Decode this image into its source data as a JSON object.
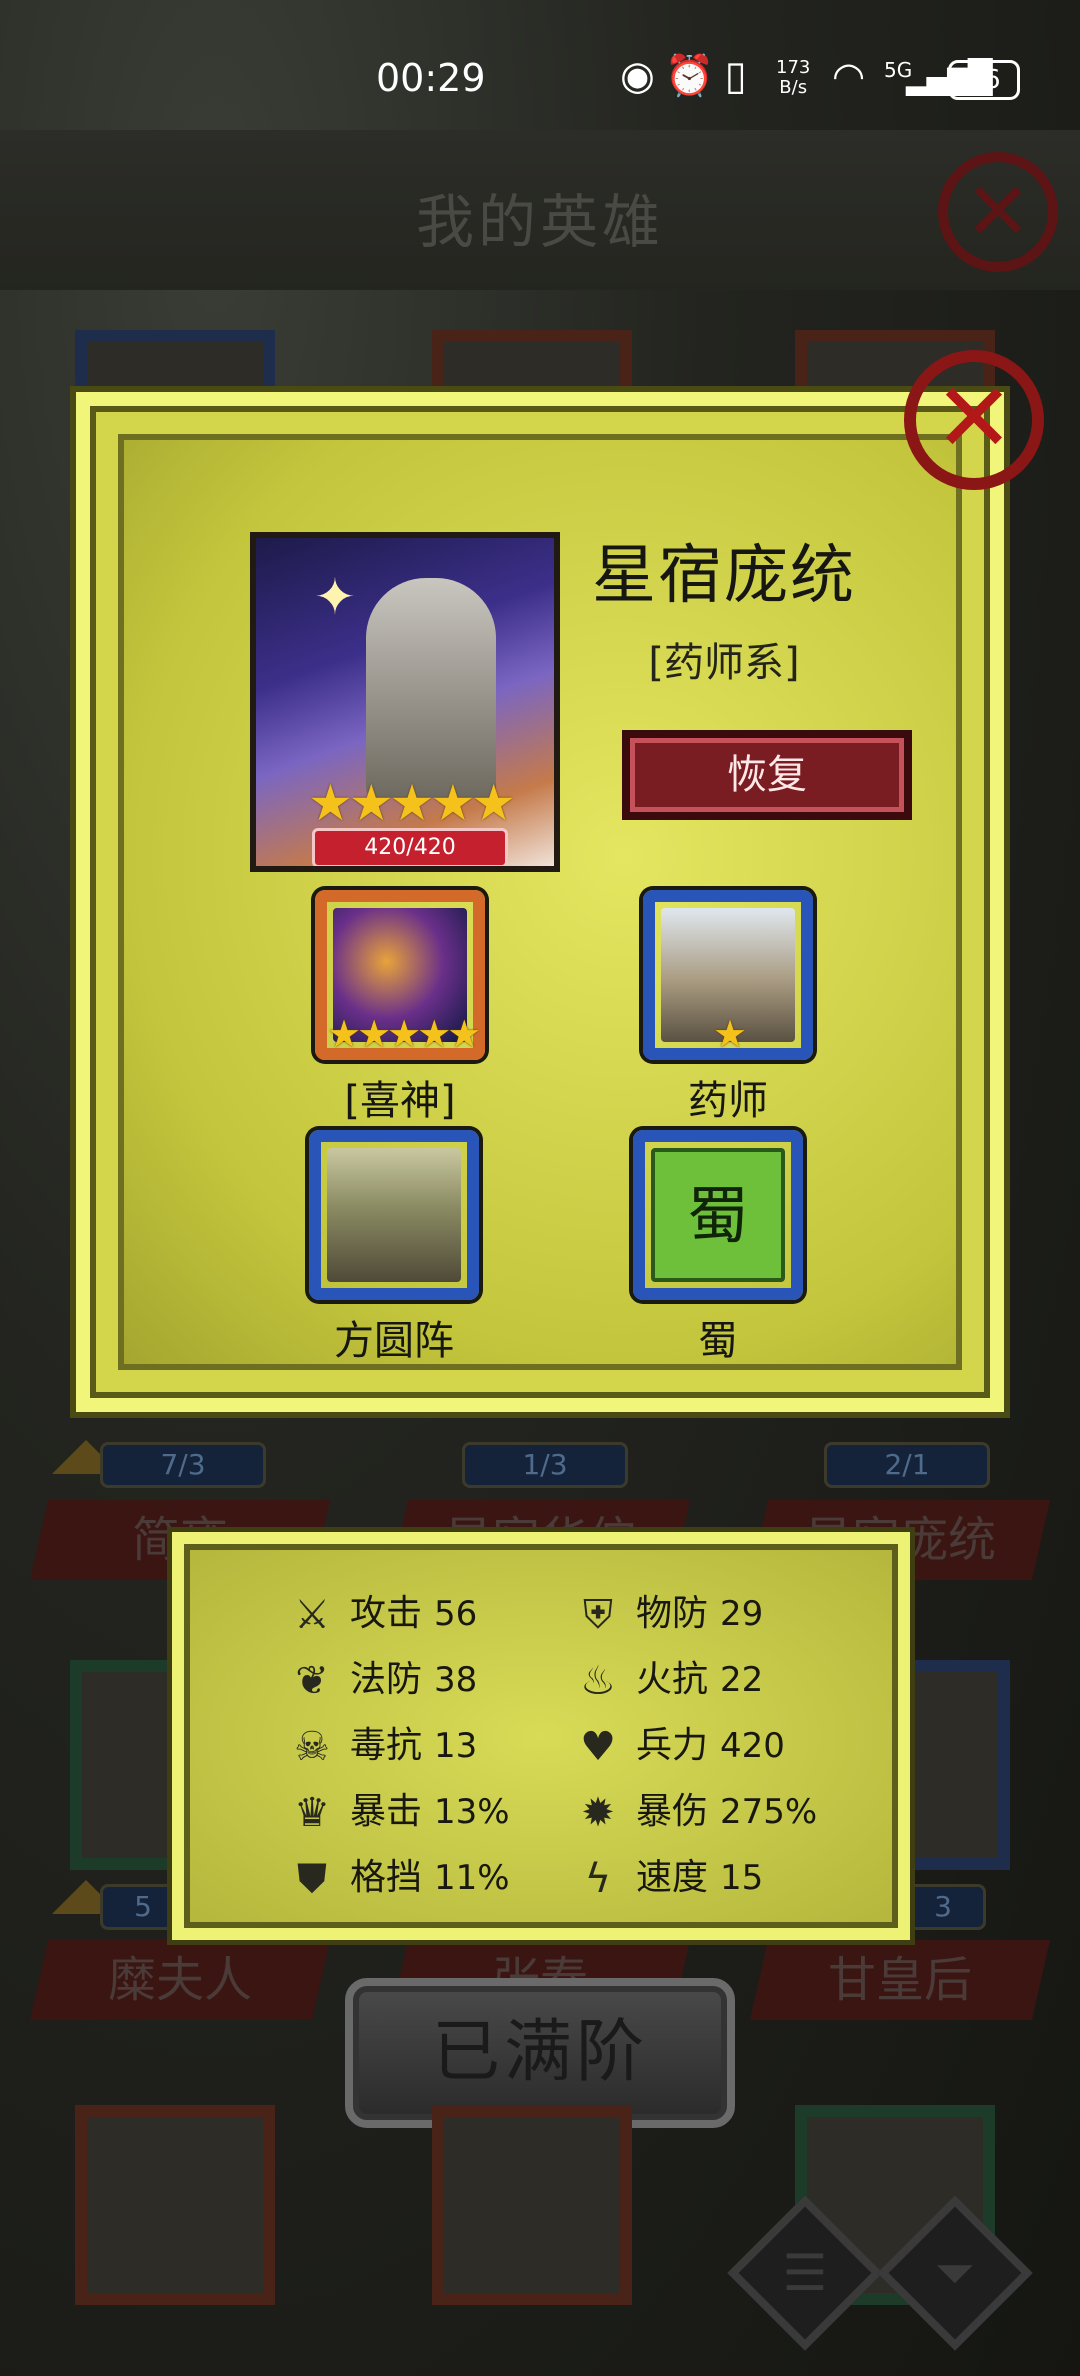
{
  "status_bar": {
    "time": "00:29",
    "net_speed_value": "173",
    "net_speed_unit": "B/s",
    "signal_label": "5G",
    "battery": "96"
  },
  "background": {
    "page_title": "我的英雄",
    "counters": [
      "7/3",
      "1/3",
      "2/1",
      "5",
      "3"
    ],
    "names": [
      "简雍",
      "星宿华佗",
      "星宿庞统",
      "糜夫人",
      "张春",
      "甘皇后"
    ],
    "max_button": "已满阶"
  },
  "hero": {
    "name": "星宿庞统",
    "class": "[药师系]",
    "hp": "420/420",
    "stars": 5,
    "restore_label": "恢复",
    "traits": [
      {
        "label": "[喜神]",
        "frame": "orange",
        "stars": "★★★★★"
      },
      {
        "label": "药师",
        "frame": "blue",
        "stars": "★"
      },
      {
        "label": "方圆阵",
        "frame": "blue",
        "stars": ""
      },
      {
        "label": "蜀",
        "frame": "blue",
        "stars": "",
        "art_text": "蜀"
      }
    ]
  },
  "stats": [
    {
      "icon": "sword-icon",
      "label": "攻击",
      "value": "56"
    },
    {
      "icon": "shield-icon",
      "label": "物防",
      "value": "29"
    },
    {
      "icon": "leaf-icon",
      "label": "法防",
      "value": "38"
    },
    {
      "icon": "fire-icon",
      "label": "火抗",
      "value": "22"
    },
    {
      "icon": "skull-icon",
      "label": "毒抗",
      "value": "13"
    },
    {
      "icon": "heart-icon",
      "label": "兵力",
      "value": "420"
    },
    {
      "icon": "crit-icon",
      "label": "暴击",
      "value": "13%"
    },
    {
      "icon": "crit-damage-icon",
      "label": "暴伤",
      "value": "275%"
    },
    {
      "icon": "block-icon",
      "label": "格挡",
      "value": "11%"
    },
    {
      "icon": "lightning-icon",
      "label": "速度",
      "value": "15"
    }
  ],
  "colors": {
    "panel": "#d3d64a",
    "panel_border": "#f1f57a",
    "restore_button": "#7a1d22",
    "close_red": "#b31818",
    "frame_blue": "#2a55b8",
    "frame_orange": "#d46a2a"
  }
}
